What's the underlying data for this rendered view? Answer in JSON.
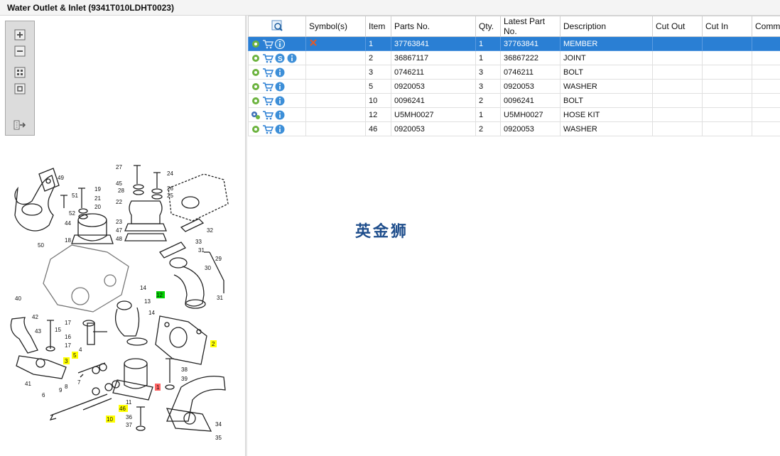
{
  "title": "Water Outlet & Inlet (9341T010LDHT0023)",
  "toolbar": {
    "zoom_in_icon": "plus-icon",
    "zoom_out_icon": "minus-icon",
    "fit_icon": "grid-icon",
    "actual_icon": "square-icon",
    "export_icon": "export-icon"
  },
  "table": {
    "columns": [
      "",
      "Symbol(s)",
      "Item",
      "Parts No.",
      "Qty.",
      "Latest Part No.",
      "Description",
      "Cut Out",
      "Cut In",
      "Comment"
    ],
    "rows": [
      {
        "item": "1",
        "parts_no": "37763841",
        "qty": "1",
        "latest": "37763841",
        "desc": "MEMBER",
        "cut_out": "",
        "cut_in": "",
        "comment": "",
        "symbol": "x-mark"
      },
      {
        "item": "2",
        "parts_no": "36867117",
        "qty": "1",
        "latest": "36867222",
        "desc": "JOINT",
        "cut_out": "",
        "cut_in": "",
        "comment": "",
        "symbol": ""
      },
      {
        "item": "3",
        "parts_no": "0746211",
        "qty": "3",
        "latest": "0746211",
        "desc": "BOLT",
        "cut_out": "",
        "cut_in": "",
        "comment": "",
        "symbol": ""
      },
      {
        "item": "5",
        "parts_no": "0920053",
        "qty": "3",
        "latest": "0920053",
        "desc": "WASHER",
        "cut_out": "",
        "cut_in": "",
        "comment": "",
        "symbol": ""
      },
      {
        "item": "10",
        "parts_no": "0096241",
        "qty": "2",
        "latest": "0096241",
        "desc": "BOLT",
        "cut_out": "",
        "cut_in": "",
        "comment": "",
        "symbol": ""
      },
      {
        "item": "12",
        "parts_no": "U5MH0027",
        "qty": "1",
        "latest": "U5MH0027",
        "desc": "HOSE KIT",
        "cut_out": "",
        "cut_in": "",
        "comment": "",
        "symbol": ""
      },
      {
        "item": "46",
        "parts_no": "0920053",
        "qty": "2",
        "latest": "0920053",
        "desc": "WASHER",
        "cut_out": "",
        "cut_in": "",
        "comment": "",
        "symbol": ""
      }
    ]
  },
  "watermark": "英金狮",
  "diagram": {
    "labels": [
      "49",
      "51",
      "19",
      "21",
      "20",
      "52",
      "44",
      "50",
      "18",
      "27",
      "24",
      "45",
      "26",
      "28",
      "25",
      "22",
      "23",
      "47",
      "48",
      "32",
      "33",
      "31",
      "30",
      "29",
      "14",
      "13",
      "12",
      "40",
      "42",
      "43",
      "15",
      "17",
      "16",
      "4",
      "5",
      "3",
      "7",
      "8",
      "9",
      "6",
      "46",
      "10",
      "11",
      "36",
      "37",
      "38",
      "39",
      "34",
      "35",
      "1",
      "2"
    ],
    "highlights": {
      "yellow": [
        "5",
        "3",
        "46",
        "10",
        "2"
      ],
      "green": [
        "12"
      ],
      "red": [
        "1"
      ]
    }
  },
  "colors": {
    "selection": "#2a7fd4",
    "yellow": "#ffff00",
    "green": "#00c800",
    "red": "#ff5a5a"
  }
}
